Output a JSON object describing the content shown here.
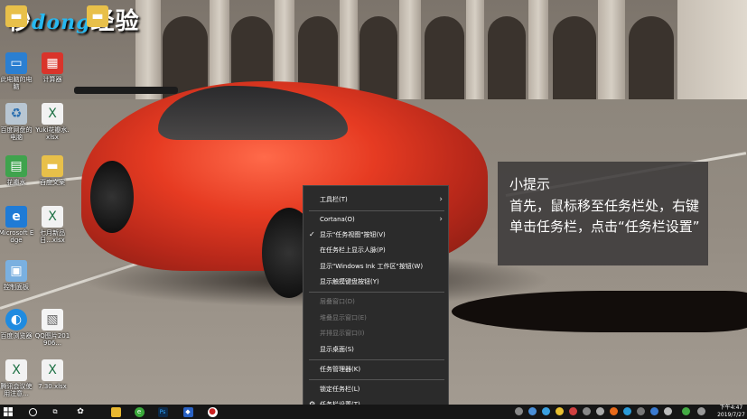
{
  "watermark": {
    "part1": "秒",
    "part2": "dong",
    "part3": "经验"
  },
  "desktop_icons": [
    {
      "label": "",
      "icon": "folder-icon"
    },
    {
      "label": "",
      "icon": "folder-icon"
    },
    {
      "label": "此电脑的电脑",
      "icon": "computer-icon"
    },
    {
      "label": "计算器",
      "icon": "calculator-icon"
    },
    {
      "label": "百度网盘的电脑",
      "icon": "recycle-bin-icon"
    },
    {
      "label": "Yuki花瓣水.xlsx",
      "icon": "excel-file-icon"
    },
    {
      "label": "花瓣水",
      "icon": "app-icon"
    },
    {
      "label": "百度文案",
      "icon": "folder-icon"
    },
    {
      "label": "Microsoft Edge",
      "icon": "edge-icon"
    },
    {
      "label": "七月新品日...xlsx",
      "icon": "excel-file-icon"
    },
    {
      "label": "控制面板",
      "icon": "control-panel-icon"
    },
    {
      "label": "百度浏览器",
      "icon": "browser-icon"
    },
    {
      "label": "QQ图片201906...",
      "icon": "image-file-icon"
    },
    {
      "label": "腾讯会议使用注意...",
      "icon": "excel-file-icon"
    },
    {
      "label": "7.30.xlsx",
      "icon": "excel-file-icon"
    }
  ],
  "tip": {
    "title": "小提示",
    "body": "首先，鼠标移至任务栏处，右键单击任务栏，点击“任务栏设置”"
  },
  "context_menu": {
    "items": [
      {
        "label": "工具栏(T)",
        "submenu": true,
        "enabled": true,
        "checked": false
      },
      {
        "label": "Cortana(O)",
        "submenu": true,
        "enabled": true,
        "checked": false
      },
      {
        "label": "显示\"任务视图\"按钮(V)",
        "submenu": false,
        "enabled": true,
        "checked": true
      },
      {
        "label": "在任务栏上显示人脉(P)",
        "submenu": false,
        "enabled": true,
        "checked": false
      },
      {
        "label": "显示\"Windows Ink 工作区\"按钮(W)",
        "submenu": false,
        "enabled": true,
        "checked": false
      },
      {
        "label": "显示触摸键盘按钮(Y)",
        "submenu": false,
        "enabled": true,
        "checked": false
      },
      {
        "label": "层叠窗口(D)",
        "submenu": false,
        "enabled": false,
        "checked": false
      },
      {
        "label": "堆叠显示窗口(E)",
        "submenu": false,
        "enabled": false,
        "checked": false
      },
      {
        "label": "并排显示窗口(I)",
        "submenu": false,
        "enabled": false,
        "checked": false
      },
      {
        "label": "显示桌面(S)",
        "submenu": false,
        "enabled": true,
        "checked": false
      },
      {
        "label": "任务管理器(K)",
        "submenu": false,
        "enabled": true,
        "checked": false
      },
      {
        "label": "锁定任务栏(L)",
        "submenu": false,
        "enabled": true,
        "checked": false
      },
      {
        "label": "任务栏设置(T)",
        "submenu": false,
        "enabled": true,
        "checked": false,
        "icon": "gear-icon"
      }
    ],
    "check_glyph": "✓",
    "arrow_glyph": "›"
  },
  "taskbar": {
    "start_icon": "windows-icon",
    "clock_time": "下午4:47",
    "clock_date": "2019/7/27",
    "pinned": [
      {
        "name": "search-icon",
        "glyph": "○",
        "color": "#161616"
      },
      {
        "name": "task-view-icon",
        "glyph": "⧉",
        "color": "#161616"
      },
      {
        "name": "fan-icon",
        "glyph": "✿",
        "color": "#161616"
      },
      {
        "name": "file-explorer-icon",
        "glyph": "",
        "color": "#e8b730"
      },
      {
        "name": "360-browser-icon",
        "glyph": "e",
        "color": "#3aa83a"
      },
      {
        "name": "photoshop-icon",
        "glyph": "Ps",
        "color": "#0c2a4a"
      },
      {
        "name": "app-blue-icon",
        "glyph": "◆",
        "color": "#2a62c4"
      },
      {
        "name": "record-icon",
        "glyph": "●",
        "color": "#cc2222"
      }
    ]
  },
  "colors": {
    "tip_bg": "#3c3a3a",
    "menu_bg": "#2b2b2b",
    "taskbar_bg": "#161616",
    "menu_disabled": "#7a7a7a"
  }
}
